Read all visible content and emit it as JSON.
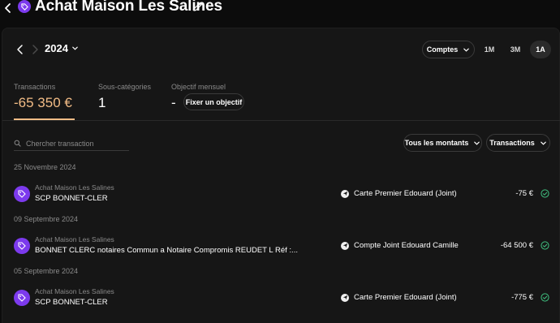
{
  "header": {
    "title": "Achat Maison Les Salines",
    "back_icon": "chevron-left-icon",
    "edit_icon": "pencil-icon",
    "category_icon": "tag-icon"
  },
  "colors": {
    "accent": "#f2bc86",
    "category": "#7c3aed",
    "success": "#3fbf7f",
    "background": "#0c0c0c",
    "panel": "#161616"
  },
  "period_nav": {
    "year": "2024",
    "prev_icon": "chevron-left-icon",
    "next_icon": "chevron-right-icon",
    "dropdown_icon": "chevron-down-icon"
  },
  "view_select": {
    "label": "Comptes",
    "icon": "chevron-down-icon"
  },
  "periods": [
    {
      "label": "1M",
      "active": false
    },
    {
      "label": "3M",
      "active": false
    },
    {
      "label": "1A",
      "active": true
    }
  ],
  "stats": {
    "transactions": {
      "label": "Transactions",
      "value": "-65 350 €"
    },
    "subcategories": {
      "label": "Sous-catégories",
      "value": "1"
    },
    "goal": {
      "label": "Objectif mensuel",
      "value": "-",
      "button": "Fixer un objectif"
    }
  },
  "filters": {
    "search_placeholder": "Chercher transaction",
    "amount_filter": "Tous les montants",
    "type_filter": "Transactions"
  },
  "groups": [
    {
      "date": "25 Novembre 2024",
      "transactions": [
        {
          "category": "Achat Maison Les Salines",
          "description": "SCP BONNET-CLER",
          "account": "Carte Premier Edouard (Joint)",
          "amount": "-75 €"
        }
      ]
    },
    {
      "date": "09 Septembre 2024",
      "transactions": [
        {
          "category": "Achat Maison Les Salines",
          "description": "BONNET CLERC notaires Commun a Notaire Compromis REUDET L Réf :...",
          "account": "Compte Joint Edouard Camille",
          "amount": "-64 500 €"
        }
      ]
    },
    {
      "date": "05 Septembre 2024",
      "transactions": [
        {
          "category": "Achat Maison Les Salines",
          "description": "SCP BONNET-CLER",
          "account": "Carte Premier Edouard (Joint)",
          "amount": "-775 €"
        }
      ]
    }
  ]
}
